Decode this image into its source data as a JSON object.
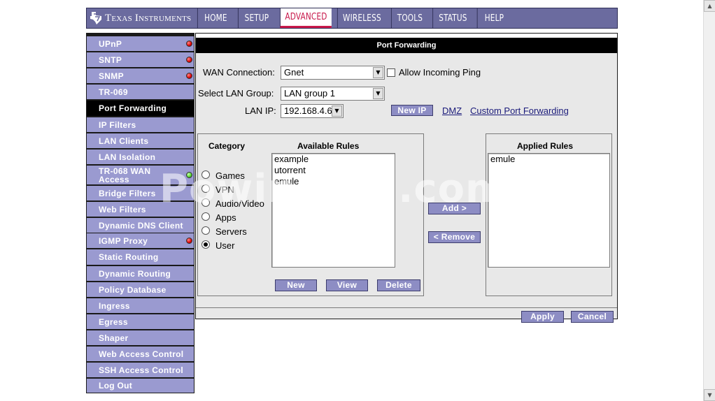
{
  "brand": {
    "name": "Texas Instruments",
    "logo_icon": "texas-state-icon"
  },
  "nav": {
    "tabs": [
      {
        "label": "HOME",
        "active": false
      },
      {
        "label": "SETUP",
        "active": false
      },
      {
        "label": "ADVANCED",
        "active": true
      },
      {
        "label": "WIRELESS",
        "active": false
      },
      {
        "label": "TOOLS",
        "active": false
      },
      {
        "label": "STATUS",
        "active": false
      },
      {
        "label": "HELP",
        "active": false
      }
    ]
  },
  "sidebar": {
    "items": [
      {
        "label": "UPnP",
        "status": "red"
      },
      {
        "label": "SNTP",
        "status": "red"
      },
      {
        "label": "SNMP",
        "status": "red"
      },
      {
        "label": "TR-069",
        "status": ""
      },
      {
        "label": "Port Forwarding",
        "status": "",
        "active": true
      },
      {
        "label": "IP Filters",
        "status": ""
      },
      {
        "label": "LAN Clients",
        "status": ""
      },
      {
        "label": "LAN Isolation",
        "status": ""
      },
      {
        "label": "TR-068 WAN Access",
        "status": "green"
      },
      {
        "label": "Bridge Filters",
        "status": ""
      },
      {
        "label": "Web Filters",
        "status": ""
      },
      {
        "label": "Dynamic DNS Client",
        "status": ""
      },
      {
        "label": "IGMP Proxy",
        "status": "red"
      },
      {
        "label": "Static Routing",
        "status": ""
      },
      {
        "label": "Dynamic Routing",
        "status": ""
      },
      {
        "label": "Policy Database",
        "status": ""
      },
      {
        "label": "Ingress",
        "status": ""
      },
      {
        "label": "Egress",
        "status": ""
      },
      {
        "label": "Shaper",
        "status": ""
      },
      {
        "label": "Web Access Control",
        "status": ""
      },
      {
        "label": "SSH Access Control",
        "status": ""
      },
      {
        "label": "Log Out",
        "status": ""
      }
    ]
  },
  "page": {
    "title": "Port Forwarding",
    "wan_connection_label": "WAN Connection:",
    "wan_connection_value": "Gnet",
    "allow_ping_label": "Allow Incoming Ping",
    "lan_group_label": "Select LAN Group:",
    "lan_group_value": "LAN group 1",
    "lan_ip_label": "LAN IP:",
    "lan_ip_value": "192.168.4.6",
    "new_ip_button": "New IP",
    "dmz_link": "DMZ",
    "custom_link": "Custom Port Forwarding"
  },
  "rules": {
    "category_title": "Category",
    "available_title": "Available Rules",
    "applied_title": "Applied Rules",
    "categories": [
      {
        "label": "Games",
        "selected": false
      },
      {
        "label": "VPN",
        "selected": false
      },
      {
        "label": "Audio/Video",
        "selected": false
      },
      {
        "label": "Apps",
        "selected": false
      },
      {
        "label": "Servers",
        "selected": false
      },
      {
        "label": "User",
        "selected": true
      }
    ],
    "available": [
      "example",
      "utorrent",
      "emule"
    ],
    "applied": [
      "emule"
    ],
    "add_button": "Add >",
    "remove_button": "< Remove",
    "new_button": "New",
    "view_button": "View",
    "delete_button": "Delete"
  },
  "footer": {
    "apply_button": "Apply",
    "cancel_button": "Cancel"
  },
  "watermark": "PowinTech.com",
  "colors": {
    "nav_bg": "#6b6b9f",
    "sidebar_item": "#9a9ad0",
    "button": "#8d8dc4",
    "active_tab_text": "#c8194b"
  }
}
